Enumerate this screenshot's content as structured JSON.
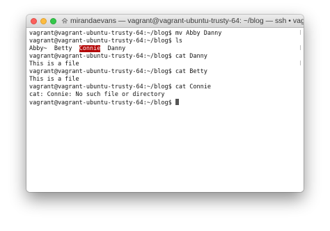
{
  "window": {
    "title": "mirandaevans — vagrant@vagrant-ubuntu-trusty-64: ~/blog — ssh • vagrant s..."
  },
  "terminal": {
    "prompt": "vagrant@vagrant-ubuntu-trusty-64:~/blog$",
    "lines": [
      {
        "kind": "prompt",
        "text": "vagrant@vagrant-ubuntu-trusty-64:~/blog$ mv Abby Danny"
      },
      {
        "kind": "prompt",
        "text": "vagrant@vagrant-ubuntu-trusty-64:~/blog$ ls"
      },
      {
        "kind": "ls"
      },
      {
        "kind": "prompt",
        "text": "vagrant@vagrant-ubuntu-trusty-64:~/blog$ cat Danny"
      },
      {
        "kind": "output",
        "text": "This is a file"
      },
      {
        "kind": "prompt",
        "text": "vagrant@vagrant-ubuntu-trusty-64:~/blog$ cat Betty"
      },
      {
        "kind": "output",
        "text": "This is a file"
      },
      {
        "kind": "prompt",
        "text": "vagrant@vagrant-ubuntu-trusty-64:~/blog$ cat Connie"
      },
      {
        "kind": "output",
        "text": "cat: Connie: No such file or directory"
      },
      {
        "kind": "current",
        "text": "vagrant@vagrant-ubuntu-trusty-64:~/blog$ "
      }
    ],
    "ls_output": [
      "Abby~",
      "Betty",
      "Connie",
      "Danny"
    ],
    "ls_highlight": "Connie",
    "highlight_color": "#b30000"
  },
  "icons": {
    "titlebar_icon": "home-icon"
  }
}
